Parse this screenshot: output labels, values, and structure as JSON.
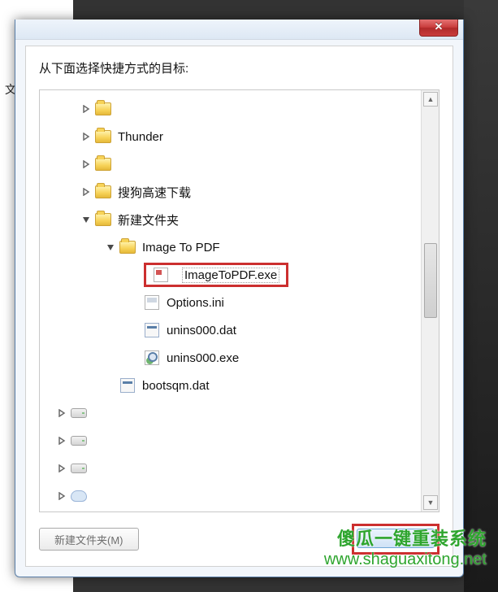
{
  "backdrop": {
    "left_text_fragment": "文件、文化"
  },
  "titlebar": {
    "close_symbol": "✕"
  },
  "dialog": {
    "label": "从下面选择快捷方式的目标:"
  },
  "tree": {
    "items": [
      {
        "indent": 1,
        "expander": "right",
        "icon": "folder",
        "label": ""
      },
      {
        "indent": 1,
        "expander": "right",
        "icon": "folder",
        "label": "Thunder"
      },
      {
        "indent": 1,
        "expander": "right",
        "icon": "folder",
        "label": ""
      },
      {
        "indent": 1,
        "expander": "right",
        "icon": "folder",
        "label": "搜狗高速下载"
      },
      {
        "indent": 1,
        "expander": "down",
        "icon": "folder",
        "label": "新建文件夹"
      },
      {
        "indent": 2,
        "expander": "down",
        "icon": "folder",
        "label": "Image To PDF"
      },
      {
        "indent": 3,
        "expander": "none",
        "icon": "exe",
        "label": "ImageToPDF.exe",
        "highlight": true,
        "focus": true
      },
      {
        "indent": 3,
        "expander": "none",
        "icon": "ini",
        "label": "Options.ini"
      },
      {
        "indent": 3,
        "expander": "none",
        "icon": "dat",
        "label": "unins000.dat"
      },
      {
        "indent": 3,
        "expander": "none",
        "icon": "uexe",
        "label": "unins000.exe"
      },
      {
        "indent": 2,
        "expander": "none",
        "icon": "dat",
        "label": "bootsqm.dat"
      },
      {
        "indent": 0,
        "expander": "right",
        "icon": "drive",
        "label": ""
      },
      {
        "indent": 0,
        "expander": "right",
        "icon": "drive",
        "label": ""
      },
      {
        "indent": 0,
        "expander": "right",
        "icon": "drive",
        "label": ""
      },
      {
        "indent": 0,
        "expander": "right",
        "icon": "cloud",
        "label": ""
      }
    ]
  },
  "footer": {
    "new_folder_label": "新建文件夹(M)"
  },
  "watermark": {
    "line1": "傻瓜一键重装系统",
    "line2": "www.shaguaxitong.net"
  }
}
